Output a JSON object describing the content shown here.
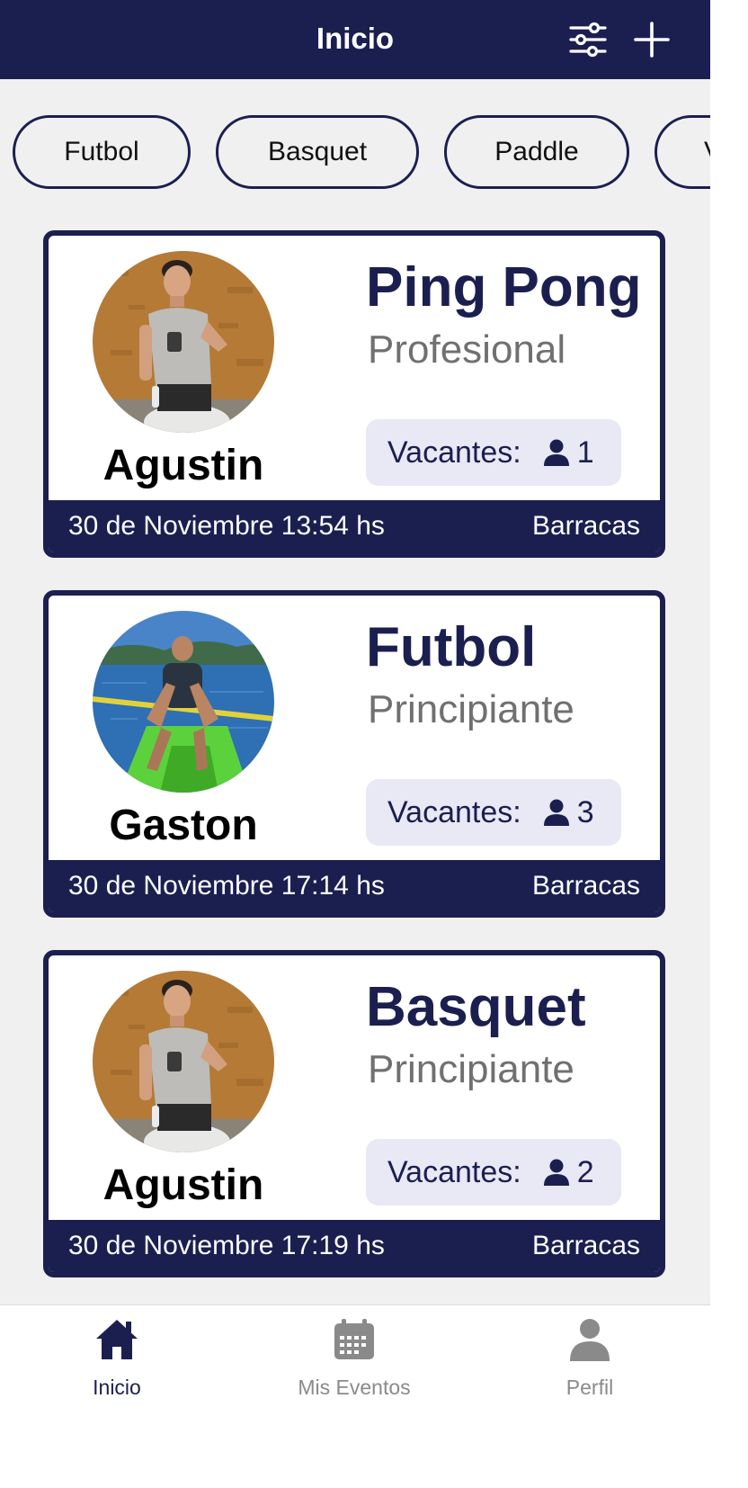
{
  "header": {
    "title": "Inicio",
    "filter_icon": "sliders-icon",
    "add_icon": "plus-icon"
  },
  "filters": [
    {
      "label": "Futbol"
    },
    {
      "label": "Basquet"
    },
    {
      "label": "Paddle"
    },
    {
      "label": "V"
    }
  ],
  "events": [
    {
      "host": "Agustin",
      "sport": "Ping Pong",
      "level": "Profesional",
      "vacancies_label": "Vacantes:",
      "vacancies": "1",
      "datetime": "30 de Noviembre 13:54 hs",
      "location": "Barracas"
    },
    {
      "host": "Gaston",
      "sport": "Futbol",
      "level": "Principiante",
      "vacancies_label": "Vacantes:",
      "vacancies": "3",
      "datetime": "30 de Noviembre 17:14 hs",
      "location": "Barracas"
    },
    {
      "host": "Agustin",
      "sport": "Basquet",
      "level": "Principiante",
      "vacancies_label": "Vacantes:",
      "vacancies": "2",
      "datetime": "30 de Noviembre 17:19 hs",
      "location": "Barracas"
    }
  ],
  "nav": [
    {
      "label": "Inicio",
      "icon": "home-icon",
      "active": true
    },
    {
      "label": "Mis Eventos",
      "icon": "calendar-icon",
      "active": false
    },
    {
      "label": "Perfil",
      "icon": "user-icon",
      "active": false
    }
  ],
  "colors": {
    "primary": "#1b1f50",
    "background": "#f0f0f0",
    "vacancy_bg": "#e8e9f4",
    "level_text": "#707070",
    "nav_inactive": "#8a8a8a"
  }
}
